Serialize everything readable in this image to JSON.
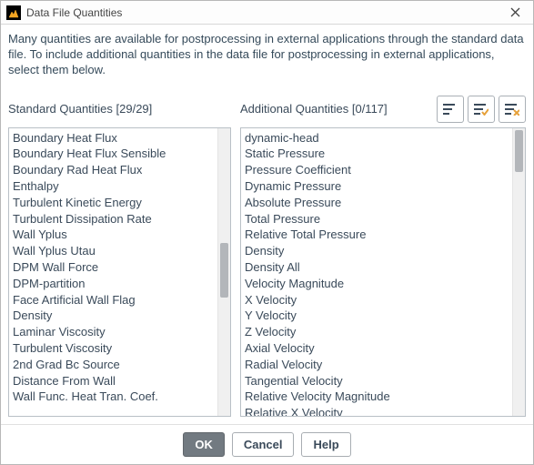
{
  "window": {
    "title": "Data File Quantities"
  },
  "description": "Many quantities are available for postprocessing in external applications through the standard data file. To include additional quantities in the data file for postprocessing in external applications, select them below.",
  "standard": {
    "header": "Standard Quantities [29/29]",
    "items": [
      "Boundary Heat Flux",
      "Boundary Heat Flux Sensible",
      "Boundary Rad Heat Flux",
      "Enthalpy",
      "Turbulent Kinetic Energy",
      "Turbulent Dissipation Rate",
      "Wall Yplus",
      "Wall Yplus Utau",
      "DPM Wall Force",
      "DPM-partition",
      "Face Artificial Wall Flag",
      "Density",
      "Laminar Viscosity",
      "Turbulent Viscosity",
      "2nd Grad Bc Source",
      "Distance From Wall",
      "Wall Func. Heat Tran. Coef."
    ]
  },
  "additional": {
    "header": "Additional Quantities [0/117]",
    "items": [
      "dynamic-head",
      "Static Pressure",
      "Pressure Coefficient",
      "Dynamic Pressure",
      "Absolute Pressure",
      "Total Pressure",
      "Relative Total Pressure",
      "Density",
      "Density All",
      "Velocity Magnitude",
      "X Velocity",
      "Y Velocity",
      "Z Velocity",
      "Axial Velocity",
      "Radial Velocity",
      "Tangential Velocity",
      "Relative Velocity Magnitude",
      "Relative X Velocity"
    ]
  },
  "buttons": {
    "ok": "OK",
    "cancel": "Cancel",
    "help": "Help"
  }
}
